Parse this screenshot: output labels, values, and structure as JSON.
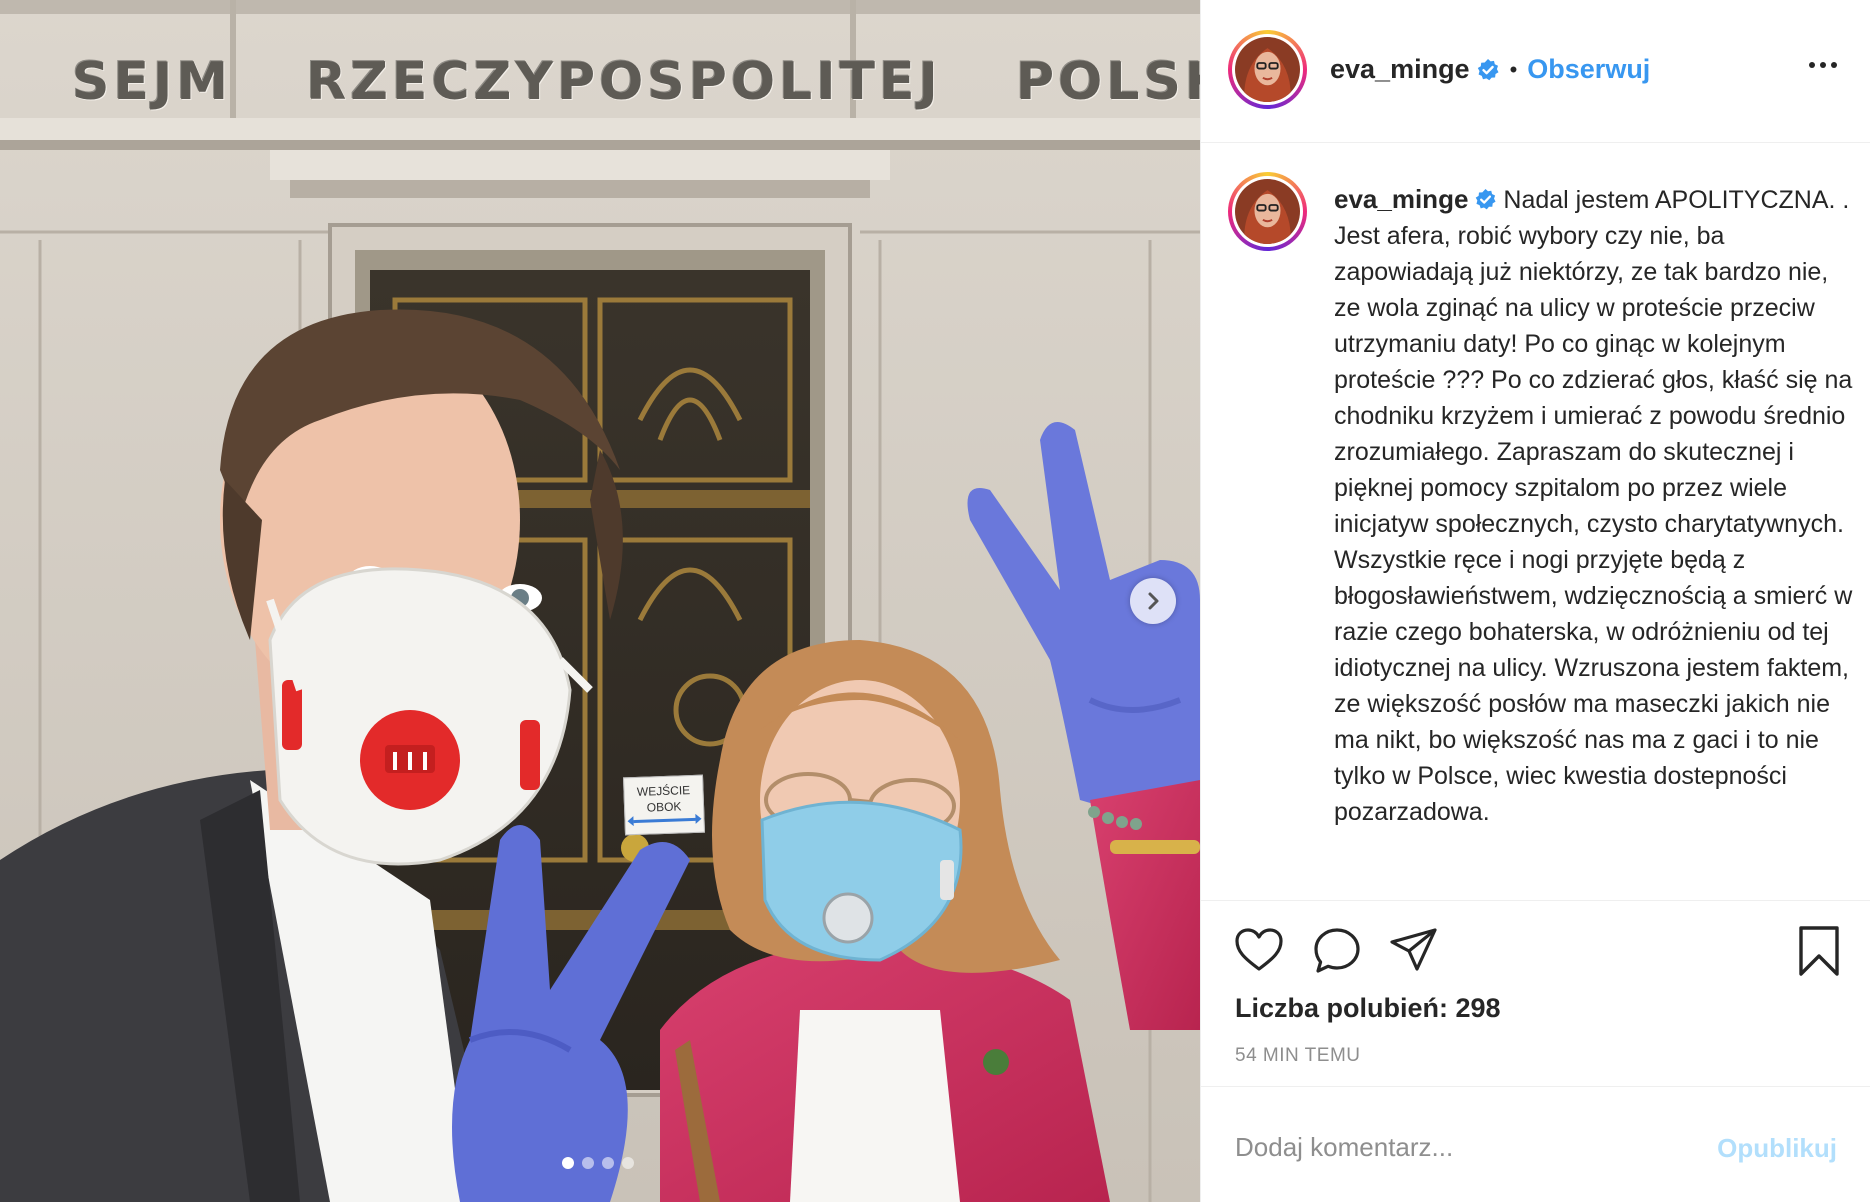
{
  "photo": {
    "facade_words": [
      "SEJM",
      "RZECZYPOSPOLITEJ",
      "POLSKIEJ"
    ],
    "door_sign_lines": [
      "WEJŚCIE",
      "OBOK"
    ],
    "carousel": {
      "total": 4,
      "active": 1
    },
    "next_icon": "chevron-right-icon"
  },
  "post": {
    "username": "eva_minge",
    "verified_icon": "verified-badge-icon",
    "separator": "•",
    "follow_label": "Obserwuj",
    "more_icon": "more-options-icon",
    "caption": "Nadal jestem APOLITYCZNA. . Jest afera, robić wybory czy nie, ba zapowiadają już niektórzy, ze tak bardzo nie, ze wola zginąć na ulicy w proteście przeciw utrzymaniu daty! Po co ginąc w kolejnym proteście ??? Po co zdzierać głos, kłaść się na chodniku krzyżem i umierać z powodu średnio zrozumiałego. Zapraszam do skutecznej i pięknej pomocy szpitalom po przez wiele inicjatyw społecznych, czysto charytatywnych. Wszystkie ręce i nogi przyjęte będą z błogosławieństwem, wdzięcznością a smierć w razie czego bohaterska, w odróżnieniu od tej idiotycznej na ulicy. Wzruszona jestem faktem, ze większość posłów ma maseczki jakich nie ma nikt, bo większość nas ma z gaci i to nie tylko w Polsce, wiec kwestia dostepności pozarzadowa.",
    "likes_text": "Liczba polubień: 298",
    "time_text": "54 MIN TEMU",
    "comment_placeholder": "Dodaj komentarz...",
    "publish_label": "Opublikuj"
  },
  "colors": {
    "link_blue": "#3897f0",
    "verified_blue": "#3897f0",
    "publish_disabled": "#b2dffc",
    "muted_text": "#8e8e8e"
  }
}
